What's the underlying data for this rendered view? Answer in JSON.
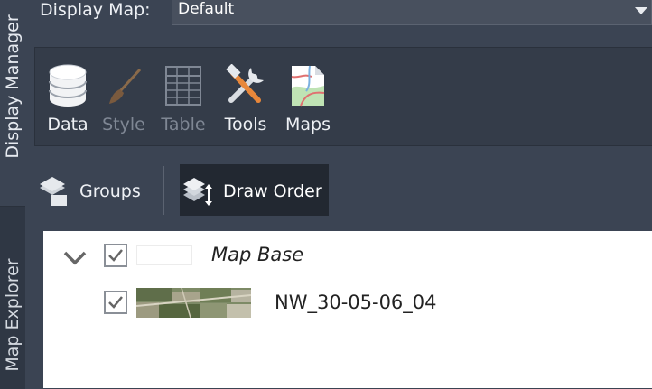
{
  "side_tabs": [
    {
      "label": "Display Manager",
      "active": true
    },
    {
      "label": "Map Explorer",
      "active": false
    }
  ],
  "display_map": {
    "label": "Display Map:",
    "value": "Default"
  },
  "ribbon": {
    "buttons": [
      {
        "label": "Data",
        "icon": "database-icon",
        "enabled": true
      },
      {
        "label": "Style",
        "icon": "paintbrush-icon",
        "enabled": false
      },
      {
        "label": "Table",
        "icon": "table-icon",
        "enabled": false
      },
      {
        "label": "Tools",
        "icon": "tools-icon",
        "enabled": true
      },
      {
        "label": "Maps",
        "icon": "map-document-icon",
        "enabled": true
      }
    ]
  },
  "view_toolbar": {
    "groups_label": "Groups",
    "draw_order_label": "Draw Order",
    "active": "Draw Order"
  },
  "tree": {
    "group": {
      "label": "Map Base",
      "checked": true,
      "expanded": true
    },
    "layers": [
      {
        "label": "NW_30-05-06_04",
        "checked": true
      }
    ]
  },
  "colors": {
    "panel_bg": "#3b4453",
    "ribbon_bg": "#343c49",
    "active_button_bg": "#222831",
    "tree_bg": "#ffffff"
  }
}
